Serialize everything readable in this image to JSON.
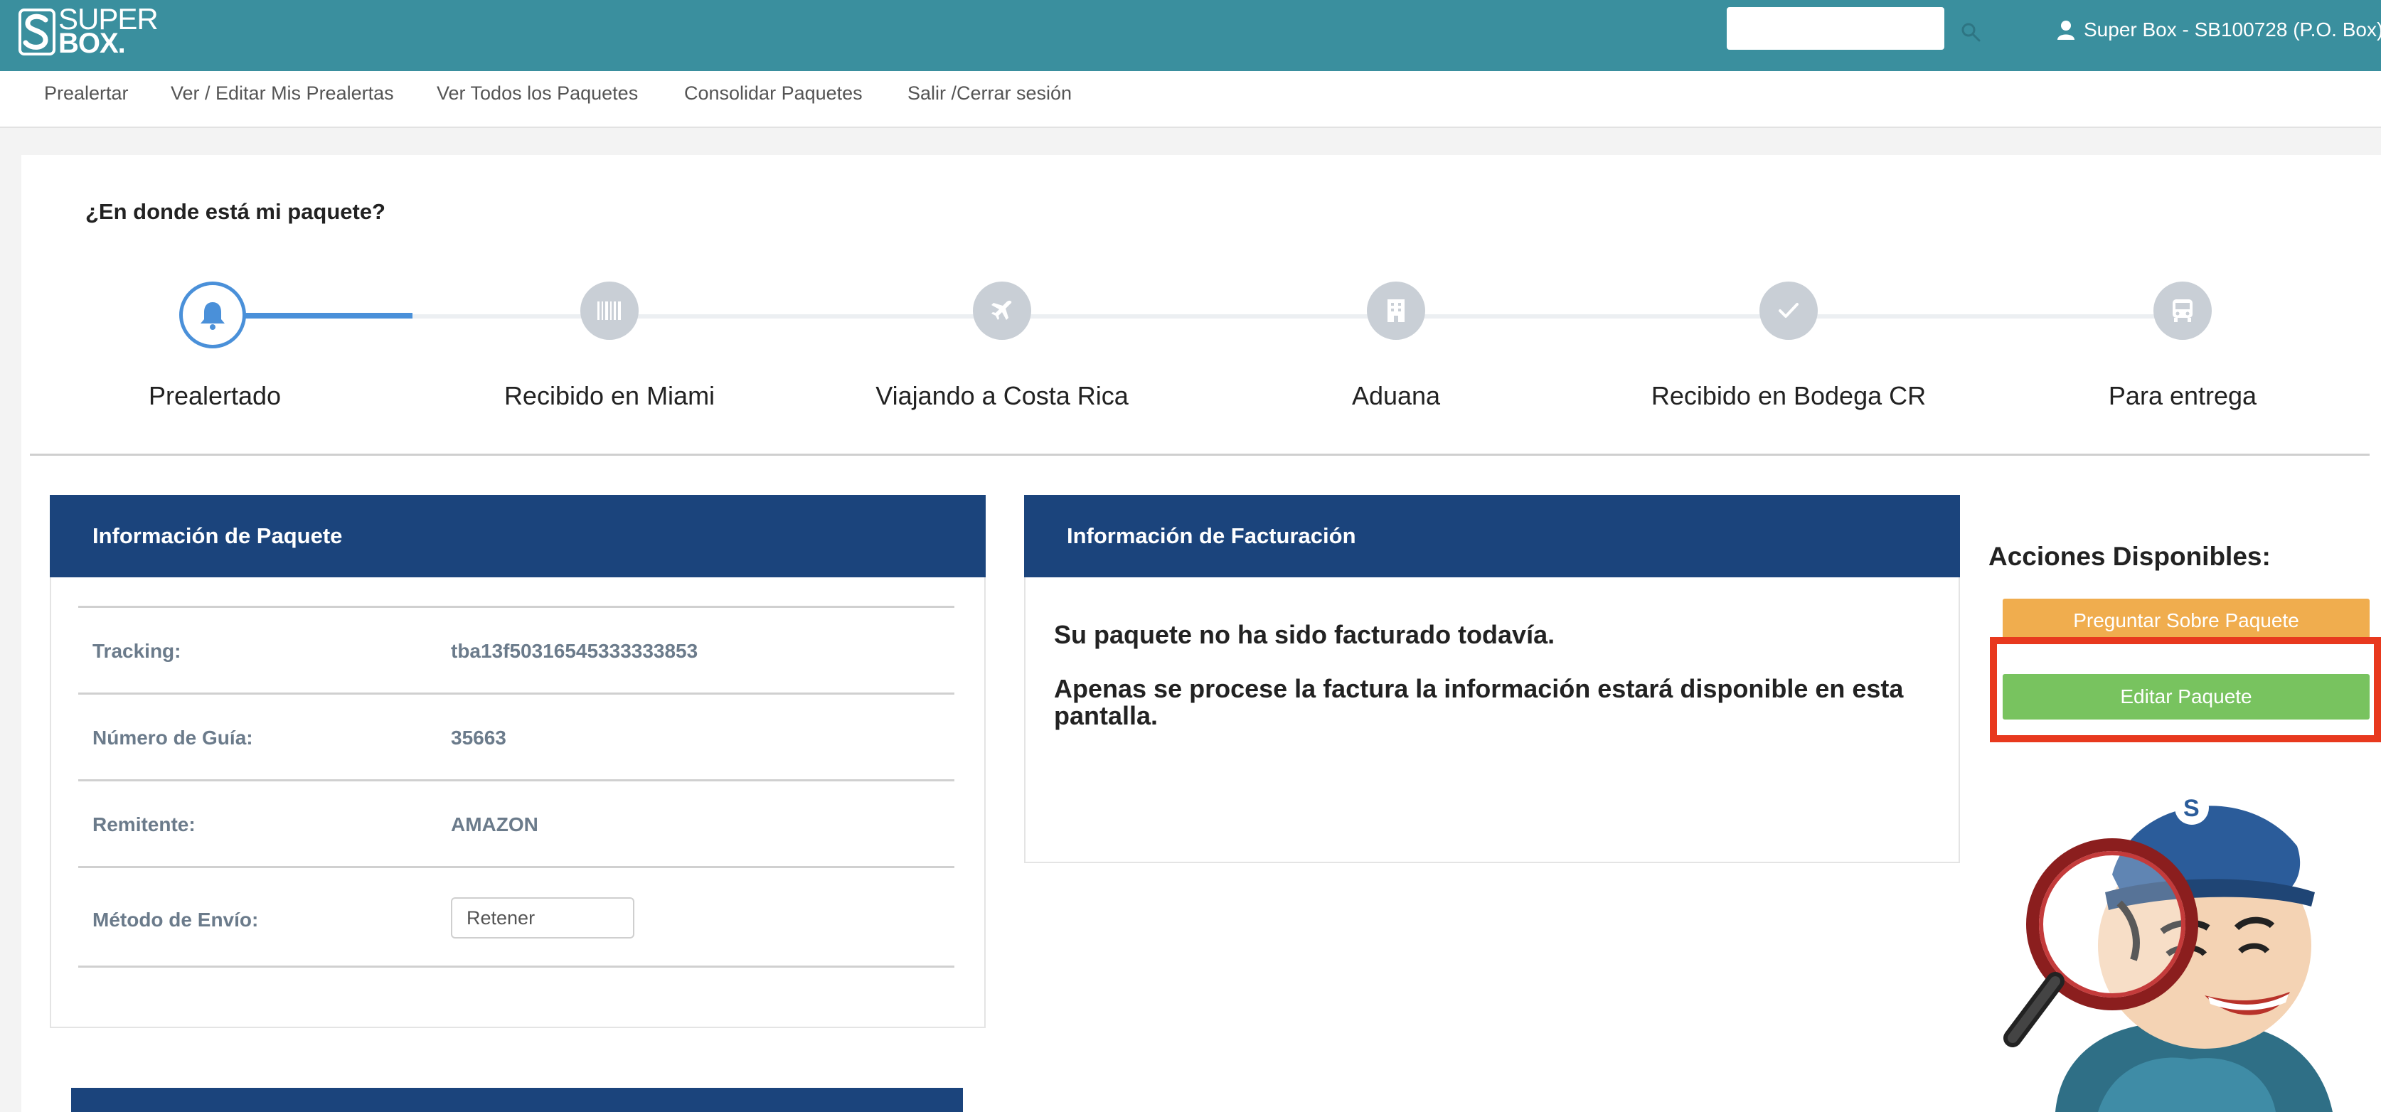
{
  "header": {
    "logo_line1": "SUPER",
    "logo_line2": "BOX.",
    "search_placeholder": "",
    "user_label": "Super Box - SB100728 (P.O. Box)"
  },
  "nav": {
    "items": [
      {
        "label": "Prealertar"
      },
      {
        "label": "Ver / Editar Mis Prealertas"
      },
      {
        "label": "Ver Todos los Paquetes"
      },
      {
        "label": "Consolidar Paquetes"
      },
      {
        "label": "Salir /Cerrar sesión"
      }
    ]
  },
  "tracking": {
    "title": "¿En donde está mi paquete?",
    "steps": [
      {
        "label": "Prealertado",
        "icon": "bell-icon",
        "active": true
      },
      {
        "label": "Recibido en Miami",
        "icon": "barcode-icon",
        "active": false
      },
      {
        "label": "Viajando a Costa Rica",
        "icon": "airplane-icon",
        "active": false
      },
      {
        "label": "Aduana",
        "icon": "building-icon",
        "active": false
      },
      {
        "label": "Recibido en Bodega CR",
        "icon": "check-icon",
        "active": false
      },
      {
        "label": "Para entrega",
        "icon": "bus-icon",
        "active": false
      }
    ]
  },
  "package_info": {
    "heading": "Información de Paquete",
    "rows": [
      {
        "label": "Tracking:",
        "value": "tba13f50316545333333853"
      },
      {
        "label": "Número de Guía:",
        "value": "35663"
      },
      {
        "label": "Remitente:",
        "value": "AMAZON"
      },
      {
        "label": "Método de Envío:",
        "value": "Retener"
      }
    ]
  },
  "billing": {
    "heading": "Información de Facturación",
    "line1": "Su paquete no ha sido facturado todavía.",
    "line2": "Apenas se procese la factura la información estará disponible en esta pantalla."
  },
  "actions": {
    "title": "Acciones Disponibles:",
    "ask_label": "Preguntar Sobre Paquete",
    "edit_label": "Editar Paquete"
  },
  "colors": {
    "header": "#3a8f9e",
    "panel_head": "#1b447c",
    "active_step": "#4a90d9",
    "ask_button": "#f0ad4e",
    "edit_button": "#78c35f",
    "highlight": "#e8391e"
  }
}
